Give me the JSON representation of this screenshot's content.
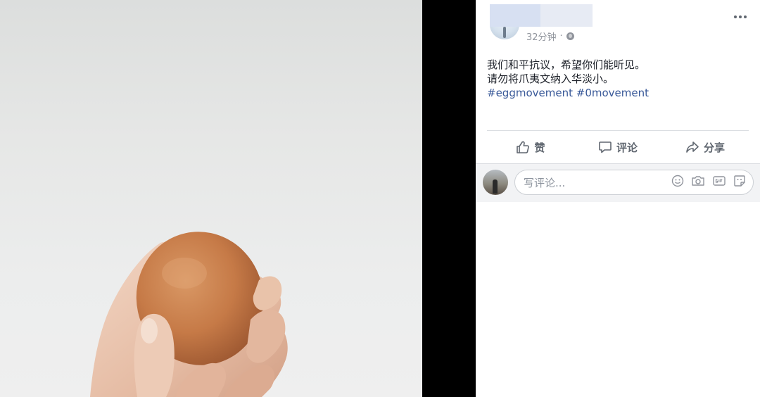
{
  "post": {
    "timestamp": "32分钟",
    "timestamp_sep": "·",
    "privacy_icon": "globe-icon",
    "text_lines": [
      "我们和平抗议，希望你们能听见。",
      "请勿将爪夷文纳入华淡小。"
    ],
    "hashtags": [
      "#eggmovement",
      "#0movement"
    ],
    "link_color": "#385898"
  },
  "actions": {
    "like_label": "赞",
    "comment_label": "评论",
    "share_label": "分享"
  },
  "comment_box": {
    "placeholder": "写评论..."
  },
  "icons": {
    "like": "thumbs-up-icon",
    "comment": "speech-bubble-icon",
    "share": "share-arrow-icon",
    "emoji": "emoji-icon",
    "camera": "camera-icon",
    "gif": "gif-icon",
    "sticker": "sticker-icon",
    "more": "more-dots-icon"
  }
}
